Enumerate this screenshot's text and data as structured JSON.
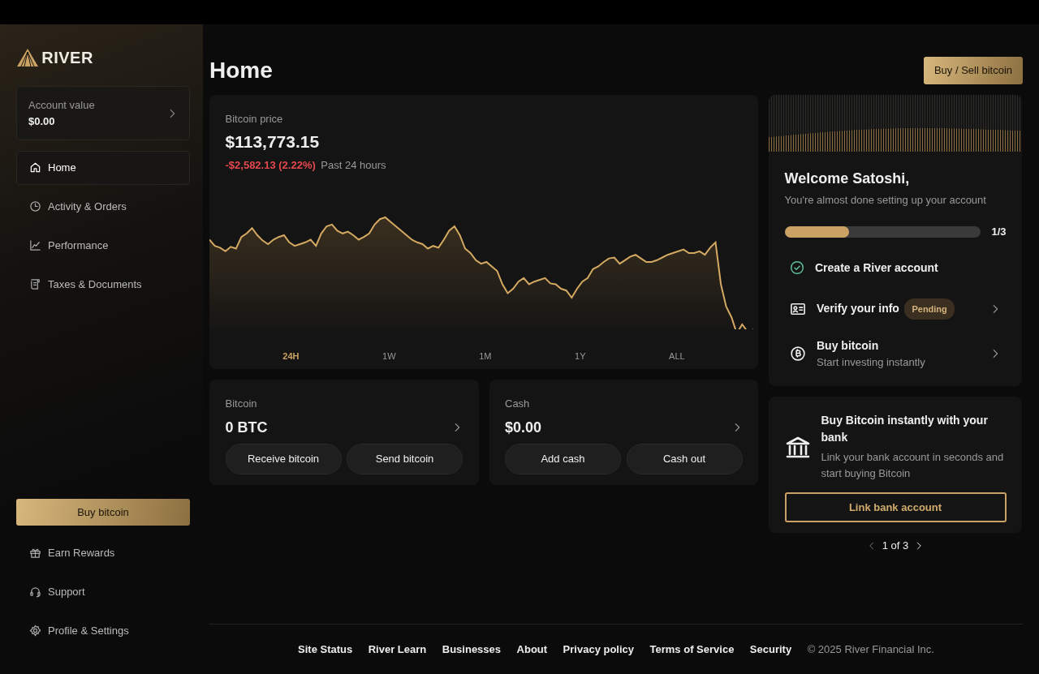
{
  "sidebar": {
    "logo": "RIVER",
    "account": {
      "label": "Account value",
      "value": "$0.00"
    },
    "items": [
      {
        "label": "Home",
        "selected": true
      },
      {
        "label": "Activity & Orders",
        "selected": false
      },
      {
        "label": "Performance",
        "selected": false
      },
      {
        "label": "Taxes & Documents",
        "selected": false
      }
    ],
    "buy_button": "Buy bitcoin",
    "footer_items": [
      {
        "label": "Earn Rewards"
      },
      {
        "label": "Support"
      },
      {
        "label": "Profile & Settings"
      }
    ]
  },
  "header": {
    "title": "Home",
    "action": "Buy / Sell bitcoin"
  },
  "price_card": {
    "label": "Bitcoin price",
    "price": "$113,773.15",
    "change": "-$2,582.13 (2.22%)",
    "period": "Past 24 hours",
    "ranges": [
      {
        "label": "24H",
        "selected": true
      },
      {
        "label": "1W",
        "selected": false
      },
      {
        "label": "1M",
        "selected": false
      },
      {
        "label": "1Y",
        "selected": false
      },
      {
        "label": "ALL",
        "selected": false
      }
    ]
  },
  "balances": [
    {
      "label": "Bitcoin",
      "value": "0 BTC",
      "actions": [
        "Receive bitcoin",
        "Send bitcoin"
      ]
    },
    {
      "label": "Cash",
      "value": "$0.00",
      "actions": [
        "Add cash",
        "Cash out"
      ]
    }
  ],
  "onboarding": {
    "title": "Welcome Satoshi,",
    "subtitle": "You're almost done setting up your account",
    "progress": {
      "level": 0.33,
      "reading": "1/3"
    },
    "steps": [
      {
        "title": "Create a River account",
        "done": true
      },
      {
        "title": "Verify your info",
        "done": false,
        "badge": "Pending"
      },
      {
        "title": "Buy bitcoin",
        "subtitle": "Start investing instantly",
        "done": false
      }
    ]
  },
  "promo": {
    "title": "Buy Bitcoin instantly with your bank",
    "text": "Link your bank account in seconds and start buying Bitcoin",
    "button": "Link bank account",
    "pager": "1 of 3"
  },
  "footer": {
    "links": [
      "Site Status",
      "River Learn",
      "Businesses",
      "About",
      "Privacy policy",
      "Terms of Service",
      "Security"
    ],
    "copyright": "© 2025 River Financial Inc."
  }
}
